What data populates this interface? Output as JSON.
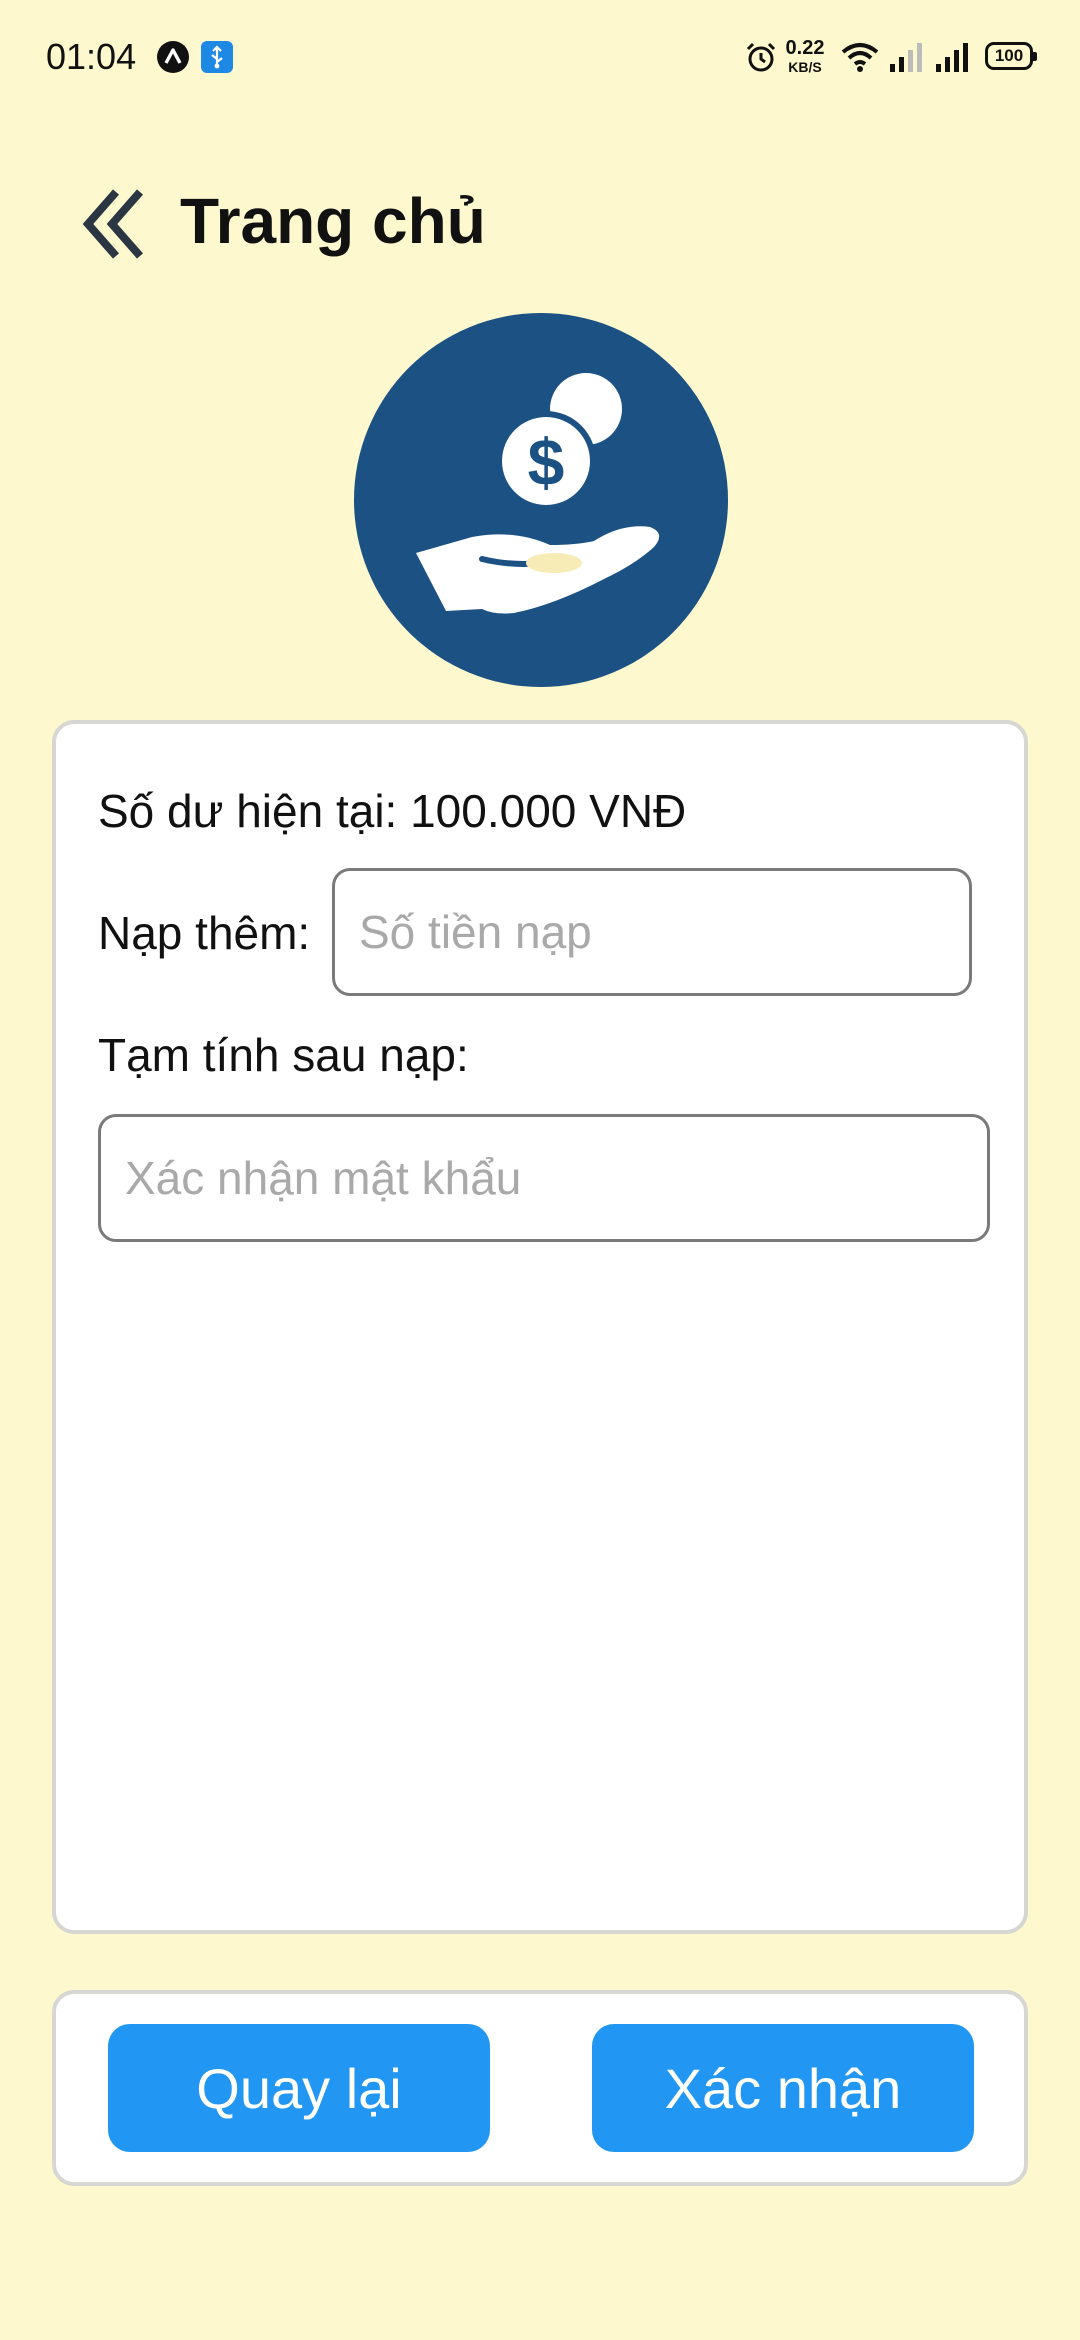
{
  "status_bar": {
    "time": "01:04",
    "net_speed_value": "0.22",
    "net_speed_unit": "KB/S",
    "battery": "100",
    "icons": [
      "a-icon",
      "usb-icon",
      "alarm-icon",
      "wifi-icon",
      "signal-icon",
      "signal-icon",
      "battery-icon"
    ]
  },
  "header": {
    "title": "Trang chủ",
    "back_icon": "double-chevron-left-icon"
  },
  "hero": {
    "icon": "hand-coin-dollar-icon",
    "circle_color": "#1B5183"
  },
  "form": {
    "balance_text": "Số dư hiện tại: 100.000 VNĐ",
    "topup_label": "Nạp thêm:",
    "topup_placeholder": "Số tiền nạp",
    "estimate_label": "Tạm tính sau nạp:",
    "estimate_placeholder": "Xác nhận mật khẩu"
  },
  "actions": {
    "back_label": "Quay lại",
    "confirm_label": "Xác nhận",
    "button_color": "#2196F3"
  },
  "colors": {
    "background": "#FEF8CF",
    "card": "#FFFFFF",
    "card_border": "#D6D6D2"
  }
}
